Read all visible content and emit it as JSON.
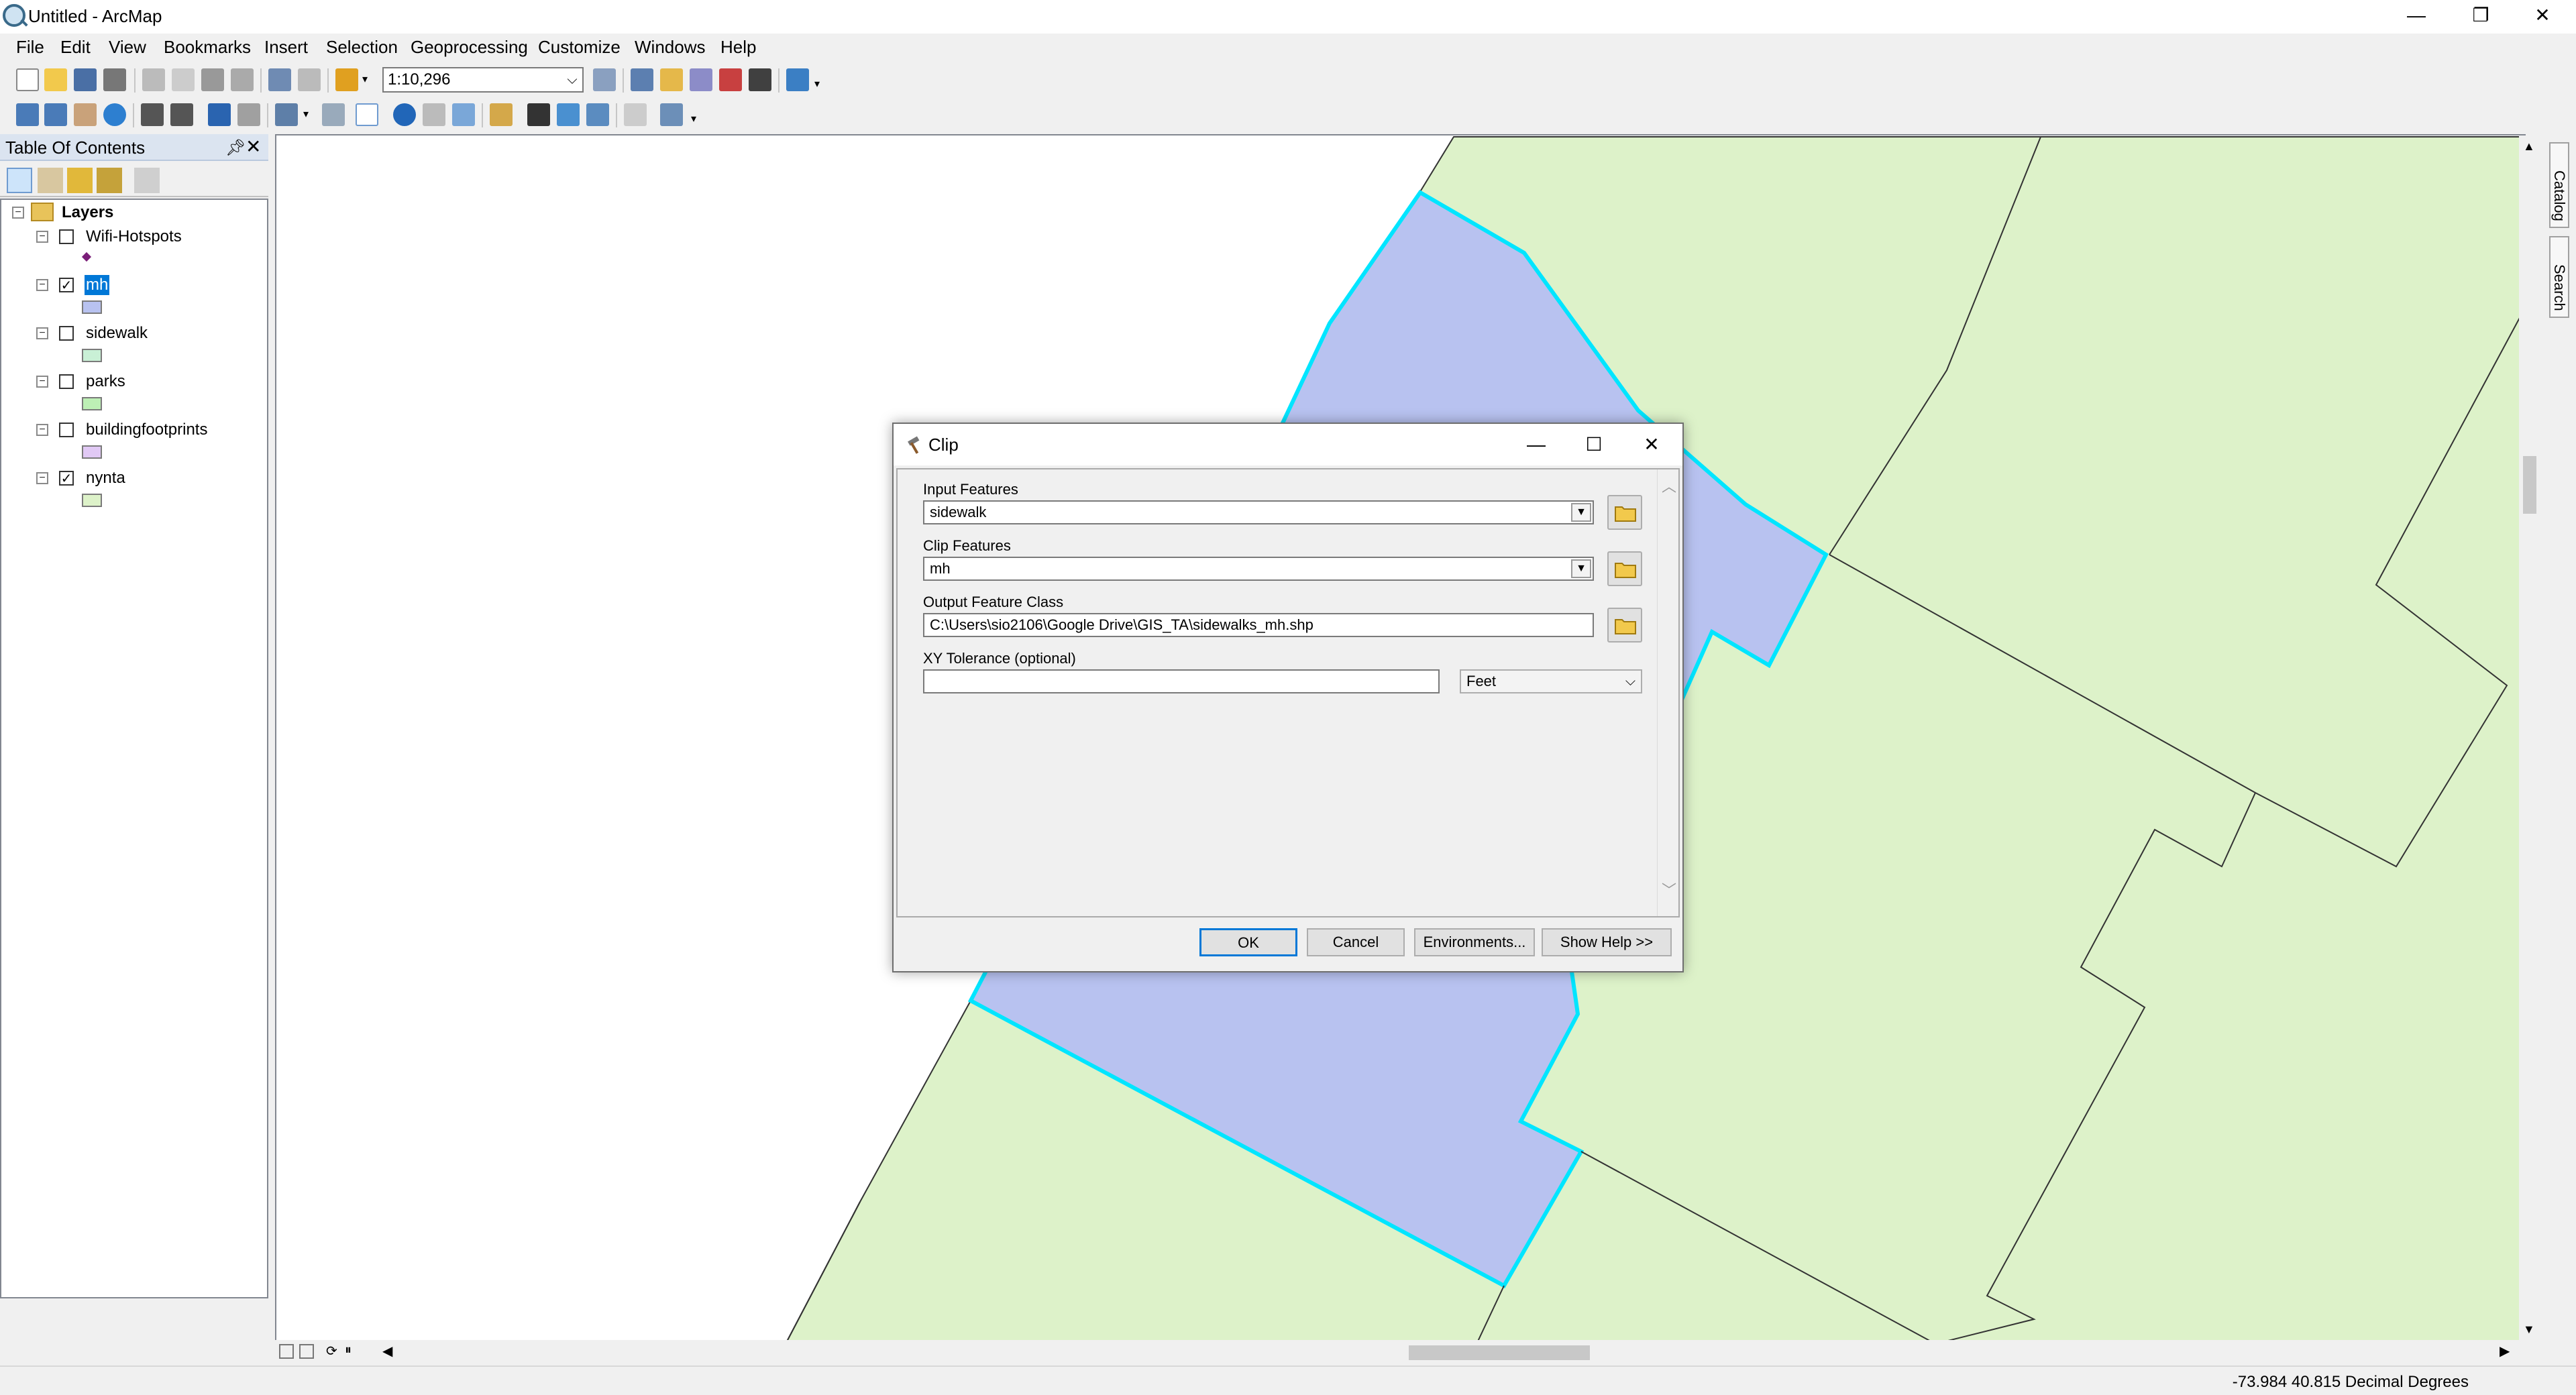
{
  "window": {
    "title": "Untitled - ArcMap",
    "controls": {
      "minimize": "—",
      "restore": "❐",
      "close": "✕"
    }
  },
  "menu": [
    "File",
    "Edit",
    "View",
    "Bookmarks",
    "Insert",
    "Selection",
    "Geoprocessing",
    "Customize",
    "Windows",
    "Help"
  ],
  "toolbar": {
    "scale": "1:10,296"
  },
  "toc": {
    "title": "Table Of Contents",
    "root": "Layers",
    "layers": [
      {
        "name": "Wifi-Hotspots",
        "checked": false,
        "symbol": "point",
        "color": "#7a1e78"
      },
      {
        "name": "mh",
        "checked": true,
        "symbol": "polygon",
        "color": "#b8c2f0",
        "selected": true
      },
      {
        "name": "sidewalk",
        "checked": false,
        "symbol": "polygon",
        "color": "#c9f0d6"
      },
      {
        "name": "parks",
        "checked": false,
        "symbol": "polygon",
        "color": "#bdf0b5"
      },
      {
        "name": "buildingfootprints",
        "checked": false,
        "symbol": "polygon",
        "color": "#e1c9f5"
      },
      {
        "name": "nynta",
        "checked": true,
        "symbol": "polygon",
        "color": "#ddf2c9"
      }
    ]
  },
  "dock": {
    "catalog": "Catalog",
    "search": "Search"
  },
  "status": {
    "coordinates": "-73.984  40.815 Decimal Degrees"
  },
  "dialog": {
    "title": "Clip",
    "input_features": {
      "label": "Input Features",
      "value": "sidewalk"
    },
    "clip_features": {
      "label": "Clip Features",
      "value": "mh"
    },
    "output": {
      "label": "Output Feature Class",
      "value": "C:\\Users\\sio2106\\Google Drive\\GIS_TA\\sidewalks_mh.shp"
    },
    "xy_tolerance": {
      "label": "XY Tolerance (optional)",
      "value": "",
      "unit": "Feet"
    },
    "buttons": {
      "ok": "OK",
      "cancel": "Cancel",
      "environments": "Environments...",
      "help": "Show Help >>"
    }
  },
  "colors": {
    "map_green": "#ddf2c9",
    "mh_fill": "#b8c2f0",
    "selection": "#00e5ff",
    "accent": "#0078d7"
  }
}
